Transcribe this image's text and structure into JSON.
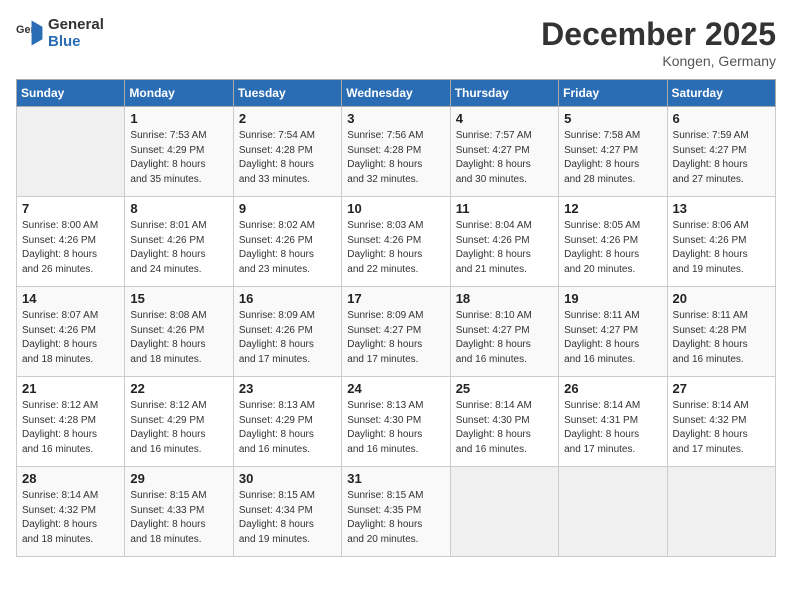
{
  "logo": {
    "line1": "General",
    "line2": "Blue"
  },
  "title": "December 2025",
  "location": "Kongen, Germany",
  "days_header": [
    "Sunday",
    "Monday",
    "Tuesday",
    "Wednesday",
    "Thursday",
    "Friday",
    "Saturday"
  ],
  "weeks": [
    [
      {
        "num": "",
        "info": ""
      },
      {
        "num": "1",
        "info": "Sunrise: 7:53 AM\nSunset: 4:29 PM\nDaylight: 8 hours\nand 35 minutes."
      },
      {
        "num": "2",
        "info": "Sunrise: 7:54 AM\nSunset: 4:28 PM\nDaylight: 8 hours\nand 33 minutes."
      },
      {
        "num": "3",
        "info": "Sunrise: 7:56 AM\nSunset: 4:28 PM\nDaylight: 8 hours\nand 32 minutes."
      },
      {
        "num": "4",
        "info": "Sunrise: 7:57 AM\nSunset: 4:27 PM\nDaylight: 8 hours\nand 30 minutes."
      },
      {
        "num": "5",
        "info": "Sunrise: 7:58 AM\nSunset: 4:27 PM\nDaylight: 8 hours\nand 28 minutes."
      },
      {
        "num": "6",
        "info": "Sunrise: 7:59 AM\nSunset: 4:27 PM\nDaylight: 8 hours\nand 27 minutes."
      }
    ],
    [
      {
        "num": "7",
        "info": "Sunrise: 8:00 AM\nSunset: 4:26 PM\nDaylight: 8 hours\nand 26 minutes."
      },
      {
        "num": "8",
        "info": "Sunrise: 8:01 AM\nSunset: 4:26 PM\nDaylight: 8 hours\nand 24 minutes."
      },
      {
        "num": "9",
        "info": "Sunrise: 8:02 AM\nSunset: 4:26 PM\nDaylight: 8 hours\nand 23 minutes."
      },
      {
        "num": "10",
        "info": "Sunrise: 8:03 AM\nSunset: 4:26 PM\nDaylight: 8 hours\nand 22 minutes."
      },
      {
        "num": "11",
        "info": "Sunrise: 8:04 AM\nSunset: 4:26 PM\nDaylight: 8 hours\nand 21 minutes."
      },
      {
        "num": "12",
        "info": "Sunrise: 8:05 AM\nSunset: 4:26 PM\nDaylight: 8 hours\nand 20 minutes."
      },
      {
        "num": "13",
        "info": "Sunrise: 8:06 AM\nSunset: 4:26 PM\nDaylight: 8 hours\nand 19 minutes."
      }
    ],
    [
      {
        "num": "14",
        "info": "Sunrise: 8:07 AM\nSunset: 4:26 PM\nDaylight: 8 hours\nand 18 minutes."
      },
      {
        "num": "15",
        "info": "Sunrise: 8:08 AM\nSunset: 4:26 PM\nDaylight: 8 hours\nand 18 minutes."
      },
      {
        "num": "16",
        "info": "Sunrise: 8:09 AM\nSunset: 4:26 PM\nDaylight: 8 hours\nand 17 minutes."
      },
      {
        "num": "17",
        "info": "Sunrise: 8:09 AM\nSunset: 4:27 PM\nDaylight: 8 hours\nand 17 minutes."
      },
      {
        "num": "18",
        "info": "Sunrise: 8:10 AM\nSunset: 4:27 PM\nDaylight: 8 hours\nand 16 minutes."
      },
      {
        "num": "19",
        "info": "Sunrise: 8:11 AM\nSunset: 4:27 PM\nDaylight: 8 hours\nand 16 minutes."
      },
      {
        "num": "20",
        "info": "Sunrise: 8:11 AM\nSunset: 4:28 PM\nDaylight: 8 hours\nand 16 minutes."
      }
    ],
    [
      {
        "num": "21",
        "info": "Sunrise: 8:12 AM\nSunset: 4:28 PM\nDaylight: 8 hours\nand 16 minutes."
      },
      {
        "num": "22",
        "info": "Sunrise: 8:12 AM\nSunset: 4:29 PM\nDaylight: 8 hours\nand 16 minutes."
      },
      {
        "num": "23",
        "info": "Sunrise: 8:13 AM\nSunset: 4:29 PM\nDaylight: 8 hours\nand 16 minutes."
      },
      {
        "num": "24",
        "info": "Sunrise: 8:13 AM\nSunset: 4:30 PM\nDaylight: 8 hours\nand 16 minutes."
      },
      {
        "num": "25",
        "info": "Sunrise: 8:14 AM\nSunset: 4:30 PM\nDaylight: 8 hours\nand 16 minutes."
      },
      {
        "num": "26",
        "info": "Sunrise: 8:14 AM\nSunset: 4:31 PM\nDaylight: 8 hours\nand 17 minutes."
      },
      {
        "num": "27",
        "info": "Sunrise: 8:14 AM\nSunset: 4:32 PM\nDaylight: 8 hours\nand 17 minutes."
      }
    ],
    [
      {
        "num": "28",
        "info": "Sunrise: 8:14 AM\nSunset: 4:32 PM\nDaylight: 8 hours\nand 18 minutes."
      },
      {
        "num": "29",
        "info": "Sunrise: 8:15 AM\nSunset: 4:33 PM\nDaylight: 8 hours\nand 18 minutes."
      },
      {
        "num": "30",
        "info": "Sunrise: 8:15 AM\nSunset: 4:34 PM\nDaylight: 8 hours\nand 19 minutes."
      },
      {
        "num": "31",
        "info": "Sunrise: 8:15 AM\nSunset: 4:35 PM\nDaylight: 8 hours\nand 20 minutes."
      },
      {
        "num": "",
        "info": ""
      },
      {
        "num": "",
        "info": ""
      },
      {
        "num": "",
        "info": ""
      }
    ]
  ]
}
